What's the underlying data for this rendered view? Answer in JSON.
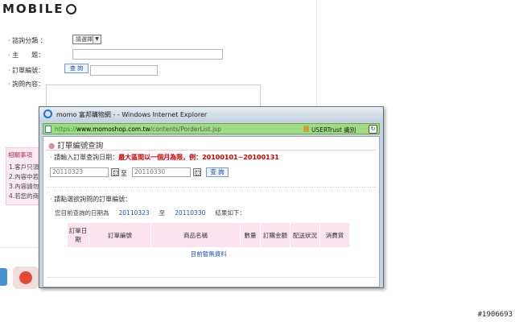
{
  "background_page": {
    "logo": "MOBILE",
    "form": {
      "category_label": "‧ 諮詢分類 ：",
      "category_value": "請選擇",
      "subject_label": "‧ 主　　題：",
      "order_no_label": "‧ 訂單編號：",
      "query_button": "查 詢",
      "content_label": "‧ 詢問內容："
    },
    "notice": {
      "title": "相關事項",
      "items": [
        "1.客戶只須提",
        "2.內容中若涉",
        "3.內容請勿輸",
        "4.若您的商品"
      ]
    }
  },
  "watermark": "#1906693",
  "ie_window": {
    "title": "momo 富邦購物網 - - Windows Internet Explorer",
    "url_scheme": "https://",
    "url_host": "www.momoshop.com.tw",
    "url_path": "/contents/PorderList.jsp",
    "cert_text": "USERTrust 識別",
    "content": {
      "section_title": "訂單編號查詢",
      "date_prompt_label": "請輸入訂單查詢日期：",
      "date_prompt_rule": "最大區間以一個月為限，例：20100101~20100131",
      "start_date": "20110323",
      "date_separator": "至",
      "end_date": "20110330",
      "query_button": "查 詢",
      "select_prompt": "請點選欲詢問的訂單編號：",
      "range_prefix": "您目前查詢的日期為",
      "range_start": "20110323",
      "range_mid": "至",
      "range_end": "20110330",
      "range_suffix": "結果如下：",
      "table_headers": [
        "訂單日期",
        "訂單編號",
        "商品名稱",
        "數量",
        "訂購金額",
        "配送狀況",
        "消費貨"
      ],
      "empty_message": "目前暫無資料"
    }
  }
}
